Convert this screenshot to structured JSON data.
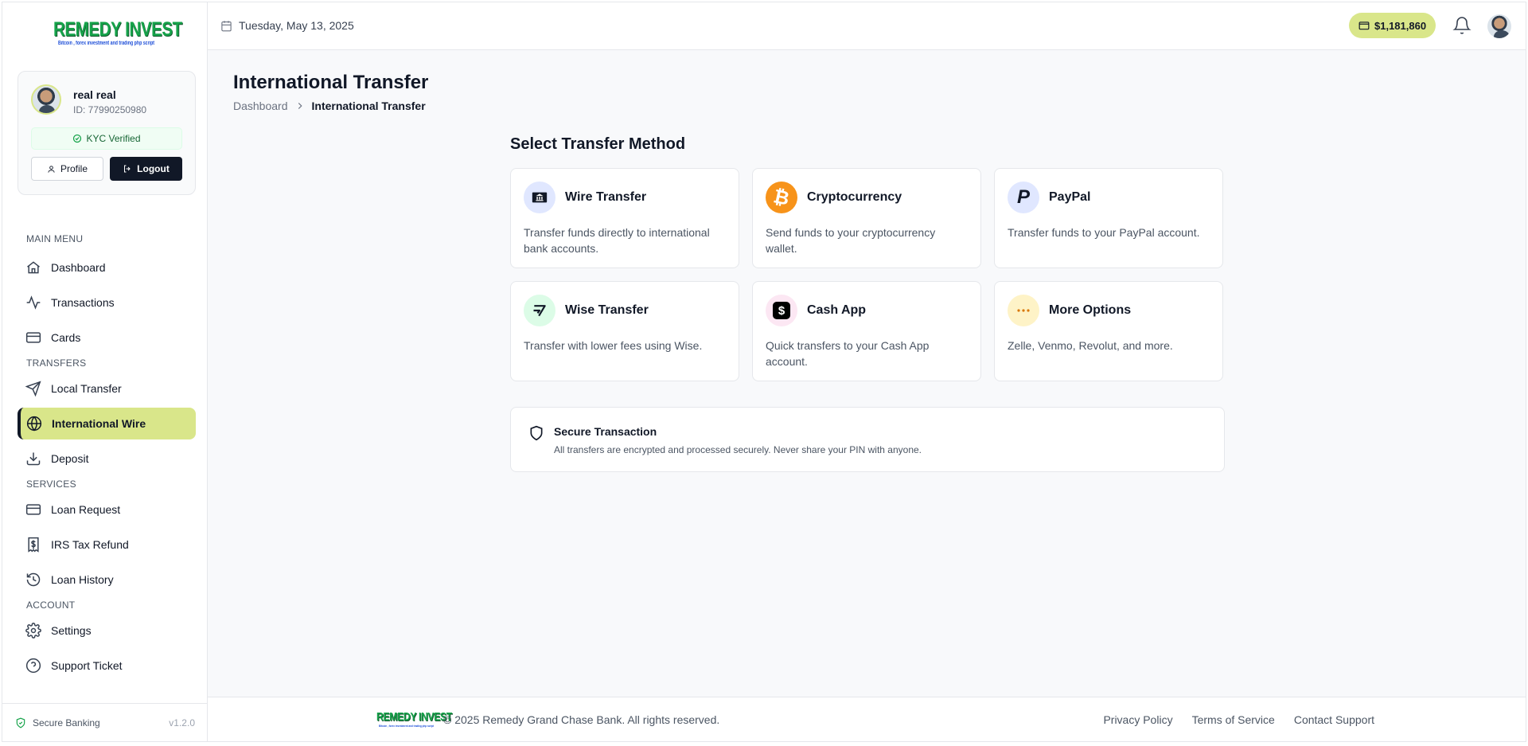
{
  "brand": {
    "logo_text": "REMEDY INVEST",
    "logo_tagline": "Bitcoin , forex investment and trading php script"
  },
  "user": {
    "name": "real real",
    "id_label": "ID: 77990250980",
    "kyc_label": "KYC Verified",
    "profile_label": "Profile",
    "logout_label": "Logout"
  },
  "sidebar": {
    "sections": {
      "main_menu": "MAIN MENU",
      "transfers": "TRANSFERS",
      "services": "SERVICES",
      "account": "ACCOUNT"
    },
    "items": [
      {
        "label": "Dashboard",
        "icon": "home-icon"
      },
      {
        "label": "Transactions",
        "icon": "activity-icon"
      },
      {
        "label": "Cards",
        "icon": "credit-card-icon"
      },
      {
        "label": "Local Transfer",
        "icon": "send-icon"
      },
      {
        "label": "International Wire",
        "icon": "globe-icon",
        "active": true
      },
      {
        "label": "Deposit",
        "icon": "download-icon"
      },
      {
        "label": "Loan Request",
        "icon": "credit-card-icon"
      },
      {
        "label": "IRS Tax Refund",
        "icon": "dollar-receipt-icon"
      },
      {
        "label": "Loan History",
        "icon": "history-icon"
      },
      {
        "label": "Settings",
        "icon": "gear-icon"
      },
      {
        "label": "Support Ticket",
        "icon": "help-circle-icon"
      }
    ],
    "footer": {
      "secure_label": "Secure Banking",
      "version": "v1.2.0"
    }
  },
  "header": {
    "date": "Tuesday, May 13, 2025",
    "balance": "$1,181,860"
  },
  "page": {
    "title": "International Transfer",
    "breadcrumb": {
      "home": "Dashboard",
      "current": "International Transfer"
    },
    "section_title": "Select Transfer Method"
  },
  "methods": [
    {
      "title": "Wire Transfer",
      "desc": "Transfer funds directly to international bank accounts.",
      "icon": "bank-icon"
    },
    {
      "title": "Cryptocurrency",
      "desc": "Send funds to your cryptocurrency wallet.",
      "icon": "bitcoin-icon"
    },
    {
      "title": "PayPal",
      "desc": "Transfer funds to your PayPal account.",
      "icon": "paypal-icon"
    },
    {
      "title": "Wise Transfer",
      "desc": "Transfer with lower fees using Wise.",
      "icon": "wise-icon"
    },
    {
      "title": "Cash App",
      "desc": "Quick transfers to your Cash App account.",
      "icon": "cashapp-icon"
    },
    {
      "title": "More Options",
      "desc": "Zelle, Venmo, Revolut, and more.",
      "icon": "more-icon"
    }
  ],
  "notice": {
    "title": "Secure Transaction",
    "text": "All transfers are encrypted and processed securely. Never share your PIN with anyone."
  },
  "footer": {
    "copyright": "© 2025 Remedy Grand Chase Bank. All rights reserved.",
    "links": [
      "Privacy Policy",
      "Terms of Service",
      "Contact Support"
    ]
  },
  "colors": {
    "accent": "#d9e68a",
    "dark": "#111827",
    "bitcoin": "#f7931a",
    "success": "#16a34a"
  }
}
